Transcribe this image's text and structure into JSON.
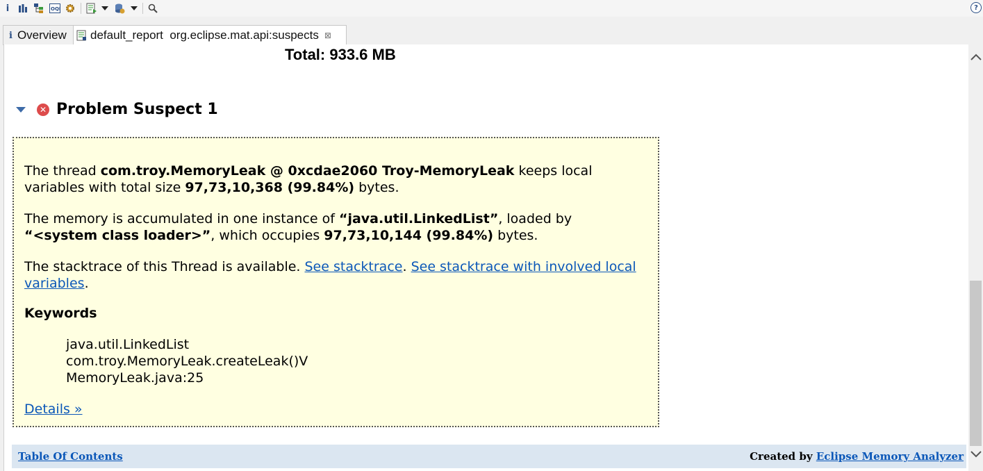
{
  "toolbar": {
    "icons": [
      "info-icon",
      "histogram-icon",
      "dominator-tree-icon",
      "oql-icon",
      "gear-icon",
      "run-report-icon",
      "dropdown-icon",
      "query-browser-icon",
      "dropdown-icon",
      "search-icon"
    ],
    "info_glyph": "i",
    "help_glyph": "?"
  },
  "tabs": {
    "overview": "Overview",
    "report": "default_report  org.eclipse.mat.api:suspects",
    "info_glyph": "i",
    "close_glyph": "⊠"
  },
  "main": {
    "total": "Total: 933.6 MB",
    "suspect_title": "Problem Suspect 1",
    "p1": {
      "t1": "The thread ",
      "b1": "com.troy.MemoryLeak @ 0xcdae2060 Troy-MemoryLeak",
      "t2": " keeps local variables with total size ",
      "b2": "97,73,10,368 (99.84%)",
      "t3": " bytes."
    },
    "p2": {
      "t1": "The memory is accumulated in one instance of ",
      "b1": "“java.util.LinkedList”",
      "t2": ", loaded by ",
      "b2": "“<system class loader>”",
      "t3": ", which occupies ",
      "b3": "97,73,10,144 (99.84%)",
      "t4": " bytes."
    },
    "p3": {
      "t1": "The stacktrace of this Thread is available. ",
      "link1": "See stacktrace",
      "t2": ". ",
      "link2": "See stacktrace with involved local variables",
      "t3": "."
    },
    "keywords_heading": "Keywords",
    "keywords": [
      "java.util.LinkedList",
      "com.troy.MemoryLeak.createLeak()V",
      "MemoryLeak.java:25"
    ],
    "details_link": "Details »"
  },
  "footer": {
    "toc": "Table Of Contents",
    "created_by": "Created by ",
    "analyzer_link": "Eclipse Memory Analyzer"
  },
  "colors": {
    "box_bg": "#ffffe1",
    "link": "#0b57b8",
    "footer_bg": "#dbe6f1",
    "error": "#dd4b4b"
  }
}
